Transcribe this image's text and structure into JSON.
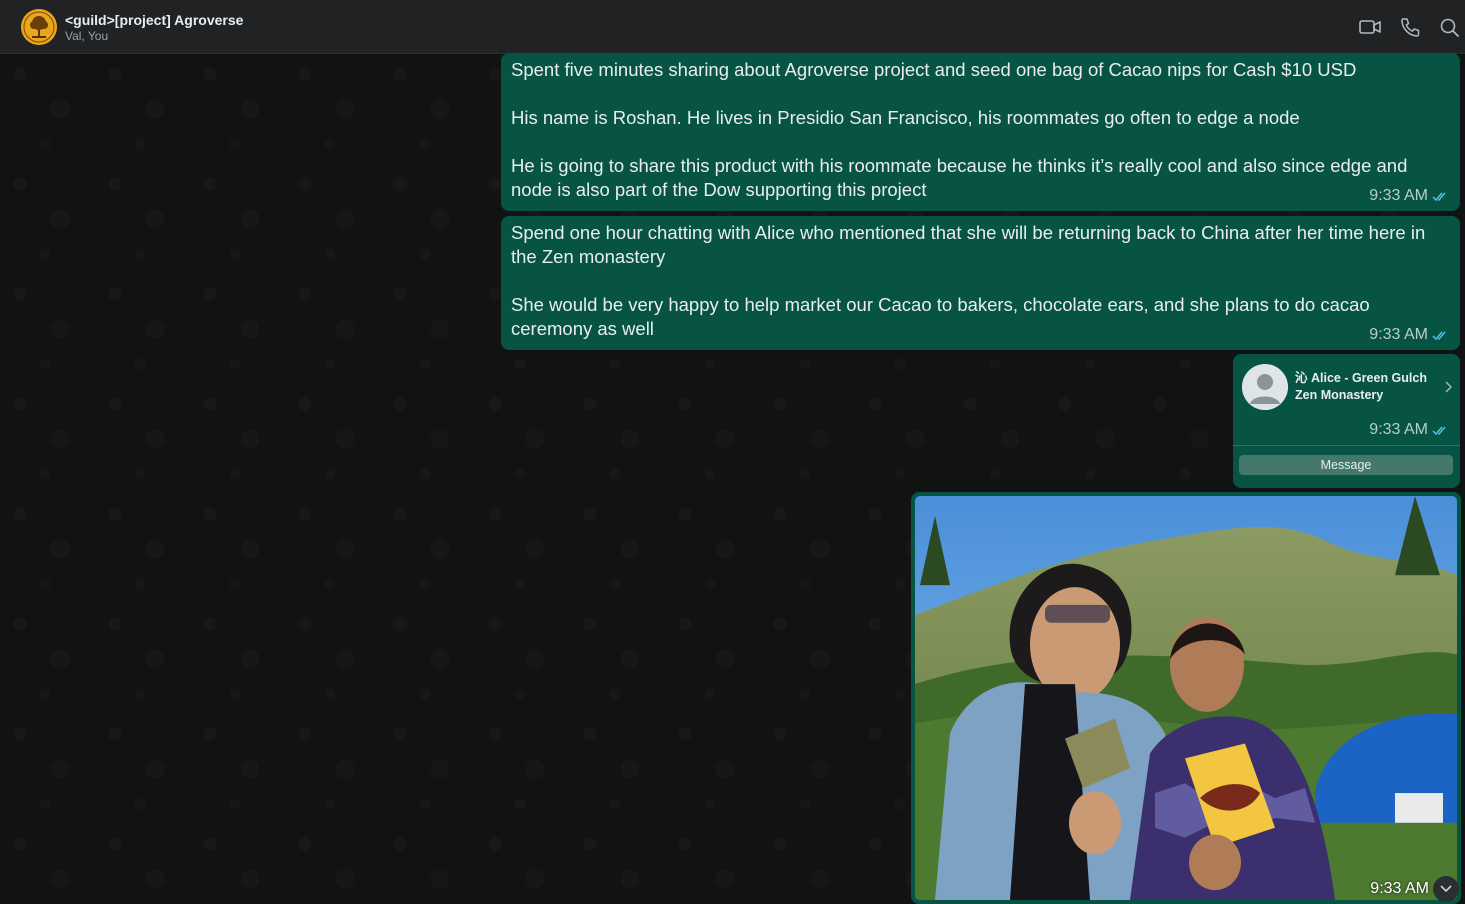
{
  "header": {
    "title": "<guild>[project] Agroverse",
    "subtitle": "Val, You",
    "icons": [
      "video-call-icon",
      "voice-call-icon",
      "search-icon"
    ]
  },
  "messages": [
    {
      "text": "Spent five minutes sharing about Agroverse project and seed one bag of Cacao nips for Cash $10 USD\n\nHis name is Roshan. He lives in Presidio San Francisco, his roommates go often to edge a node\n\nHe is going to share this product with his roommate because he thinks it’s really cool and also since edge and node is also part of the Dow supporting this project",
      "time": "9:33 AM"
    },
    {
      "text": "Spend one hour chatting with Alice who mentioned that she will be returning back to China after her time here in the Zen monastery\n\nShe would be very happy to help market our Cacao to bakers, chocolate ears, and she plans to do cacao ceremony as well",
      "time": "9:33 AM"
    }
  ],
  "contact_card": {
    "name": "沁 Alice - Green Gulch Zen Monastery",
    "time": "9:33 AM",
    "button_label": "Message"
  },
  "photo_message": {
    "time": "9:33 AM"
  },
  "colors": {
    "bubble": "#075444",
    "header": "#202224",
    "background": "#111313",
    "read_ticks": "#53bdeb"
  }
}
